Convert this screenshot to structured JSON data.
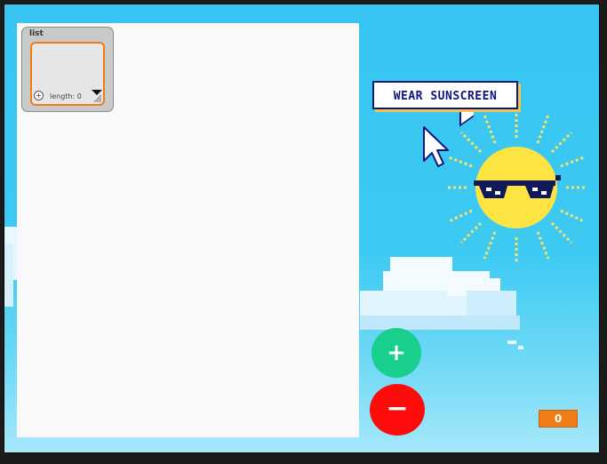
{
  "list_monitor": {
    "title": "list",
    "add_symbol": "+",
    "length_label": "length: 0"
  },
  "speech_bubble": {
    "text": "WEAR SUNSCREEN"
  },
  "buttons": {
    "plus_label": "+",
    "minus_label": "−"
  },
  "counter": {
    "value": "0"
  },
  "icons": [
    "mouse-cursor-icon",
    "sun-with-sunglasses-icon",
    "cloud-icon",
    "add-item-icon",
    "resize-handle-icon"
  ],
  "colors": {
    "sky": "#37c4f2",
    "accent_orange": "#ee7d16",
    "plus_green": "#19cf8e",
    "minus_red": "#ff0b0b",
    "bubble_ink": "#10157e"
  }
}
